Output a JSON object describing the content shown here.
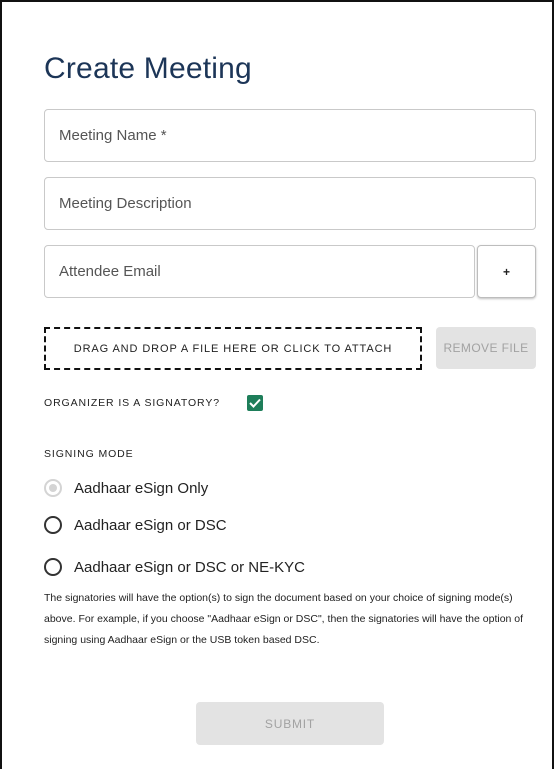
{
  "form": {
    "title": "Create Meeting",
    "meeting_name": {
      "placeholder": "Meeting Name *",
      "value": ""
    },
    "meeting_description": {
      "placeholder": "Meeting Description",
      "value": ""
    },
    "attendee_email": {
      "placeholder": "Attendee Email",
      "value": ""
    },
    "add_attendee_label": "+",
    "dropzone_label": "DRAG AND DROP A FILE HERE OR CLICK TO ATTACH",
    "remove_file_label": "REMOVE FILE",
    "organizer_signatory_label": "ORGANIZER IS A SIGNATORY?",
    "organizer_signatory_checked": true,
    "signing_mode_label": "SIGNING MODE",
    "signing_modes": [
      {
        "label": "Aadhaar eSign Only",
        "selected": true,
        "disabled": true
      },
      {
        "label": "Aadhaar eSign or DSC",
        "selected": false,
        "disabled": false
      },
      {
        "label": "Aadhaar eSign or DSC or NE-KYC",
        "selected": false,
        "disabled": false
      }
    ],
    "note": "The signatories will have the option(s) to sign the document based on your choice of signing mode(s) above. For example, if you choose \"Aadhaar eSign or DSC\", then the signatories will have the option of signing using Aadhaar eSign or the USB token based DSC.",
    "submit_label": "SUBMIT"
  },
  "colors": {
    "title": "#1c3557",
    "checkbox_checked": "#1e7e5a",
    "disabled_button_bg": "#e3e3e3",
    "disabled_button_text": "#a2a2a2"
  },
  "icons": {
    "checkbox": "check-icon",
    "radio_selected_disabled": "radio-dot-icon"
  }
}
